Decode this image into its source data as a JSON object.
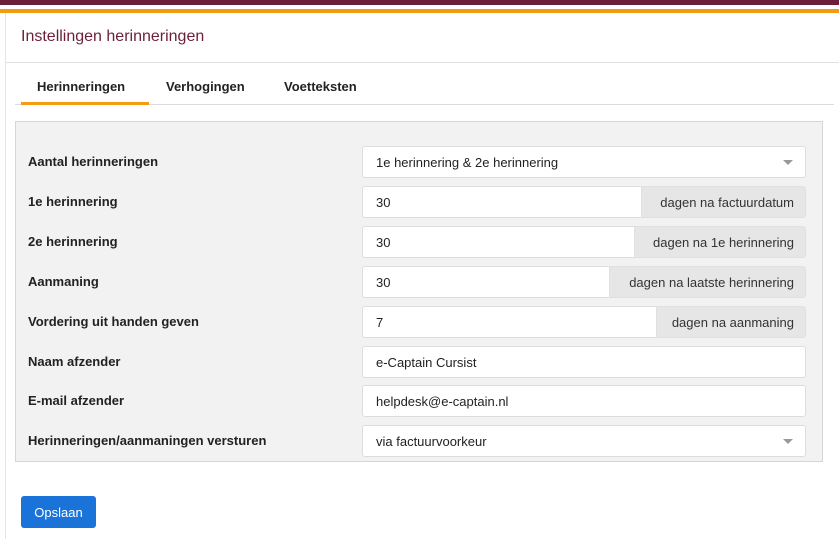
{
  "header": {
    "title": "Instellingen herinneringen"
  },
  "tabs": [
    {
      "label": "Herinneringen",
      "active": true
    },
    {
      "label": "Verhogingen",
      "active": false
    },
    {
      "label": "Voetteksten",
      "active": false
    }
  ],
  "form": {
    "aantal": {
      "label": "Aantal herinneringen",
      "value": "1e herinnering & 2e herinnering"
    },
    "eerste": {
      "label": "1e herinnering",
      "value": "30",
      "addon": "dagen na factuurdatum"
    },
    "tweede": {
      "label": "2e herinnering",
      "value": "30",
      "addon": "dagen na 1e herinnering"
    },
    "aanmaning": {
      "label": "Aanmaning",
      "value": "30",
      "addon": "dagen na laatste herinnering"
    },
    "vordering": {
      "label": "Vordering uit handen geven",
      "value": "7",
      "addon": "dagen na aanmaning"
    },
    "naam": {
      "label": "Naam afzender",
      "value": "e-Captain Cursist"
    },
    "email": {
      "label": "E-mail afzender",
      "value": "helpdesk@e-captain.nl"
    },
    "versturen": {
      "label": "Herinneringen/aanmaningen versturen",
      "value": "via factuurvoorkeur"
    }
  },
  "actions": {
    "save_label": "Opslaan"
  },
  "colors": {
    "brand": "#6b1f3a",
    "accent": "#f39c12",
    "primary_button": "#1a73d9"
  }
}
